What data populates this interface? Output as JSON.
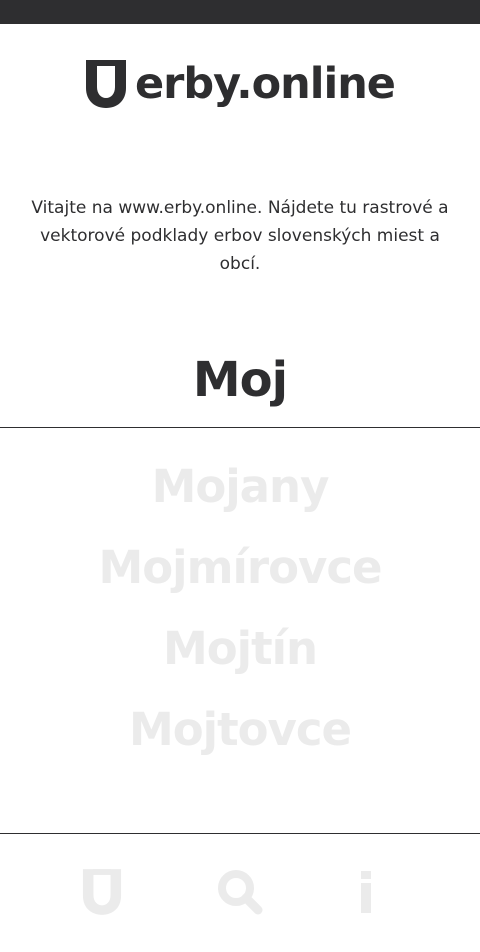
{
  "header": {
    "brand": "erby.online",
    "logo_icon": "shield-icon"
  },
  "intro": {
    "text": "Vitajte na www.erby.online. Nájdete tu rastrové a vektorové podklady erbov slovenských miest a obcí."
  },
  "search": {
    "query": "Moj"
  },
  "results": [
    {
      "label": "Mojany"
    },
    {
      "label": "Mojmírovce"
    },
    {
      "label": "Mojtín"
    },
    {
      "label": "Mojtovce"
    }
  ],
  "bottom_nav": [
    {
      "icon": "shield-icon"
    },
    {
      "icon": "search-icon"
    },
    {
      "icon": "info-icon"
    }
  ],
  "colors": {
    "dark": "#2e2e30",
    "inactive": "#ebebeb",
    "background": "#ffffff"
  }
}
